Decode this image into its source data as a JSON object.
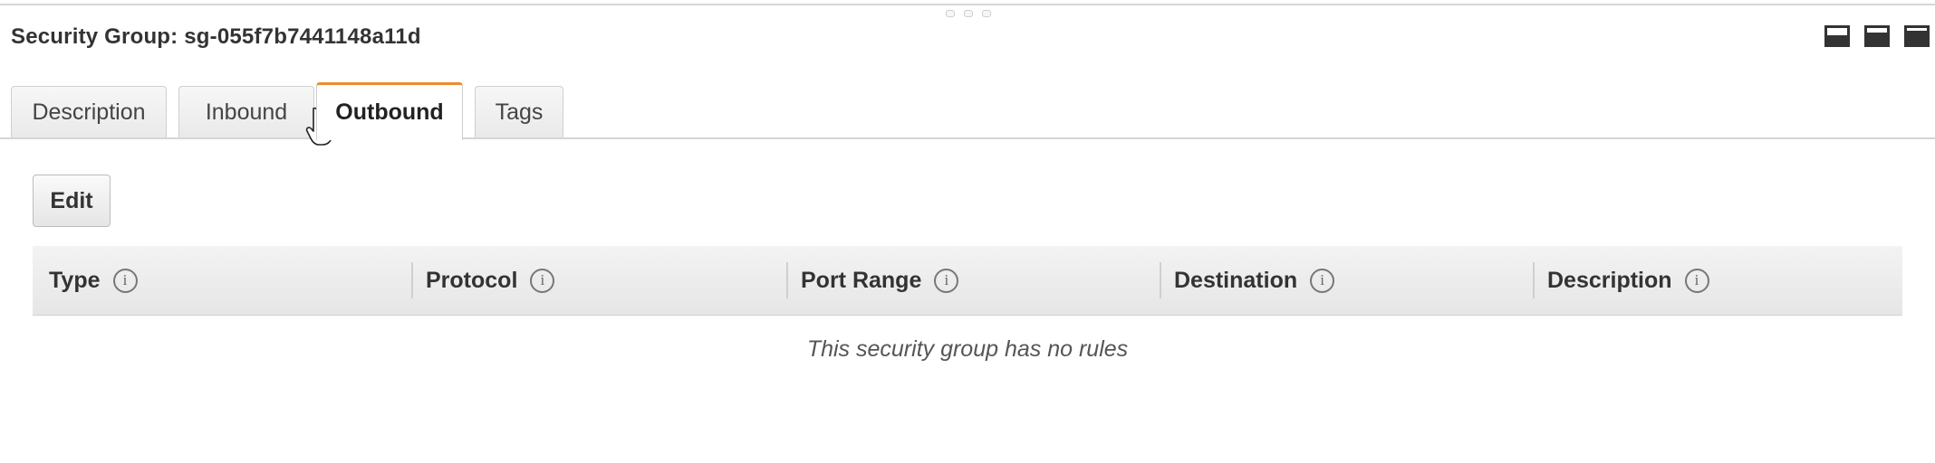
{
  "panel": {
    "title": "Security Group: sg-055f7b7441148a11d"
  },
  "layout_icons": [
    "layout-bottom-small-icon",
    "layout-bottom-medium-icon",
    "layout-full-icon"
  ],
  "tabs": [
    {
      "label": "Description",
      "active": false
    },
    {
      "label": "Inbound",
      "active": false
    },
    {
      "label": "Outbound",
      "active": true
    },
    {
      "label": "Tags",
      "active": false
    }
  ],
  "actions": {
    "edit_label": "Edit"
  },
  "table": {
    "columns": [
      "Type",
      "Protocol",
      "Port Range",
      "Destination",
      "Description"
    ],
    "info_glyph": "i",
    "empty_message": "This security group has no rules"
  },
  "colors": {
    "active_tab_accent": "#ec8b2e"
  }
}
